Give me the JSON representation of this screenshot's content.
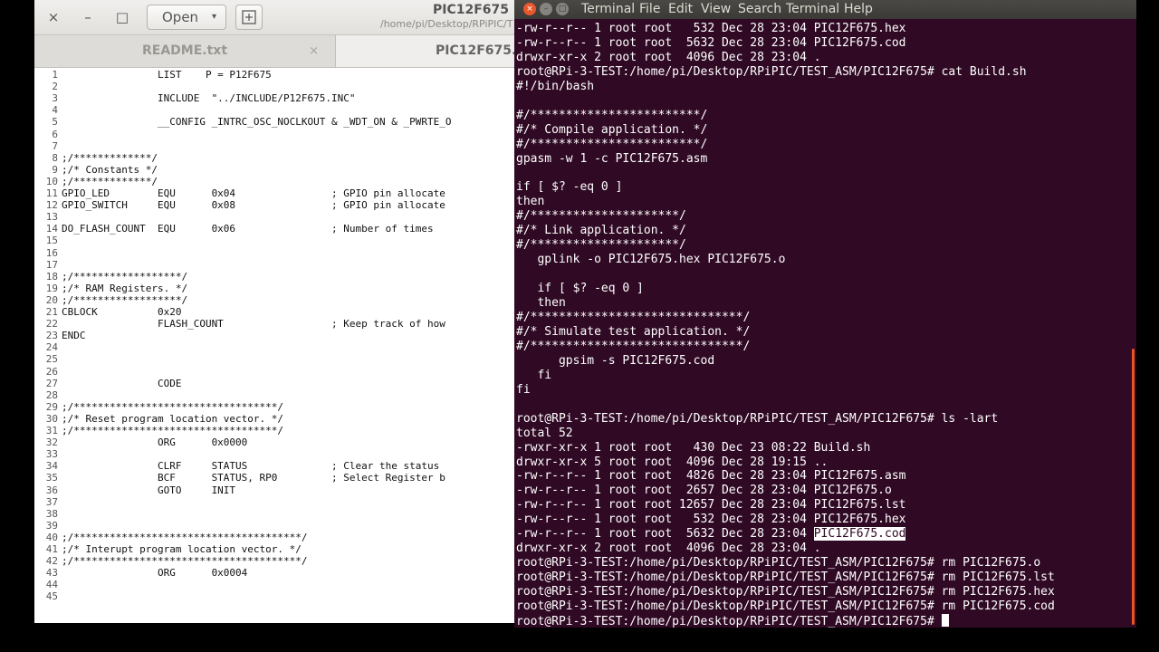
{
  "editor": {
    "window_buttons": {
      "close": "×",
      "minimize": "–",
      "maximize": "□"
    },
    "open_label": "Open",
    "open_chevron": "▾",
    "title": "PIC12F675",
    "path": "/home/pi/Desktop/RPiPIC/T",
    "tabs": [
      {
        "label": "README.txt",
        "close": "×"
      },
      {
        "label": "PIC12F675."
      }
    ],
    "lines": [
      {
        "n": "1",
        "text": "                LIST    P = P12F675"
      },
      {
        "n": "2",
        "text": ""
      },
      {
        "n": "3",
        "text": "                INCLUDE  \"../INCLUDE/P12F675.INC\""
      },
      {
        "n": "4",
        "text": ""
      },
      {
        "n": "5",
        "text": "                __CONFIG _INTRC_OSC_NOCLKOUT & _WDT_ON & _PWRTE_O"
      },
      {
        "n": "6",
        "text": ""
      },
      {
        "n": "7",
        "text": ""
      },
      {
        "n": "8",
        "text": ";/*************/"
      },
      {
        "n": "9",
        "text": ";/* Constants */"
      },
      {
        "n": "10",
        "text": ";/*************/"
      },
      {
        "n": "11",
        "text": "GPIO_LED        EQU      0x04                ; GPIO pin allocate"
      },
      {
        "n": "12",
        "text": "GPIO_SWITCH     EQU      0x08                ; GPIO pin allocate"
      },
      {
        "n": "13",
        "text": ""
      },
      {
        "n": "14",
        "text": "DO_FLASH_COUNT  EQU      0x06                ; Number of times "
      },
      {
        "n": "15",
        "text": ""
      },
      {
        "n": "16",
        "text": ""
      },
      {
        "n": "17",
        "text": ""
      },
      {
        "n": "18",
        "text": ";/******************/"
      },
      {
        "n": "19",
        "text": ";/* RAM Registers. */"
      },
      {
        "n": "20",
        "text": ";/******************/"
      },
      {
        "n": "21",
        "text": "CBLOCK          0x20"
      },
      {
        "n": "22",
        "text": "                FLASH_COUNT                  ; Keep track of how"
      },
      {
        "n": "23",
        "text": "ENDC"
      },
      {
        "n": "24",
        "text": ""
      },
      {
        "n": "25",
        "text": ""
      },
      {
        "n": "26",
        "text": ""
      },
      {
        "n": "27",
        "text": "                CODE"
      },
      {
        "n": "28",
        "text": ""
      },
      {
        "n": "29",
        "text": ";/**********************************/"
      },
      {
        "n": "30",
        "text": ";/* Reset program location vector. */"
      },
      {
        "n": "31",
        "text": ";/**********************************/"
      },
      {
        "n": "32",
        "text": "                ORG      0x0000"
      },
      {
        "n": "33",
        "text": ""
      },
      {
        "n": "34",
        "text": "                CLRF     STATUS              ; Clear the status"
      },
      {
        "n": "35",
        "text": "                BCF      STATUS, RP0         ; Select Register b"
      },
      {
        "n": "36",
        "text": "                GOTO     INIT"
      },
      {
        "n": "37",
        "text": ""
      },
      {
        "n": "38",
        "text": ""
      },
      {
        "n": "39",
        "text": ""
      },
      {
        "n": "40",
        "text": ";/**************************************/"
      },
      {
        "n": "41",
        "text": ";/* Interupt program location vector. */"
      },
      {
        "n": "42",
        "text": ";/**************************************/"
      },
      {
        "n": "43",
        "text": "                ORG      0x0004"
      },
      {
        "n": "44",
        "text": ""
      },
      {
        "n": "45",
        "text": ""
      }
    ]
  },
  "terminal": {
    "window_buttons": {
      "close": "×",
      "minimize": "–",
      "maximize": "□"
    },
    "menu": [
      "Terminal",
      "File",
      "Edit",
      "View",
      "Search",
      "Terminal",
      "Help"
    ],
    "lines": [
      "-rw-r--r-- 1 root root   532 Dec 28 23:04 PIC12F675.hex",
      "-rw-r--r-- 1 root root  5632 Dec 28 23:04 PIC12F675.cod",
      "drwxr-xr-x 2 root root  4096 Dec 28 23:04 .",
      "root@RPi-3-TEST:/home/pi/Desktop/RPiPIC/TEST_ASM/PIC12F675# cat Build.sh",
      "#!/bin/bash",
      "",
      "#/************************/",
      "#/* Compile application. */",
      "#/************************/",
      "gpasm -w 1 -c PIC12F675.asm",
      "",
      "if [ $? -eq 0 ]",
      "then",
      "#/*********************/",
      "#/* Link application. */",
      "#/*********************/",
      "   gplink -o PIC12F675.hex PIC12F675.o",
      "",
      "   if [ $? -eq 0 ]",
      "   then",
      "#/******************************/",
      "#/* Simulate test application. */",
      "#/******************************/",
      "      gpsim -s PIC12F675.cod",
      "   fi",
      "fi",
      "",
      "root@RPi-3-TEST:/home/pi/Desktop/RPiPIC/TEST_ASM/PIC12F675# ls -lart",
      "total 52",
      "-rwxr-xr-x 1 root root   430 Dec 23 08:22 Build.sh",
      "drwxr-xr-x 5 root root  4096 Dec 28 19:15 ..",
      "-rw-r--r-- 1 root root  4826 Dec 28 23:04 PIC12F675.asm",
      "-rw-r--r-- 1 root root  2657 Dec 28 23:04 PIC12F675.o",
      "-rw-r--r-- 1 root root 12657 Dec 28 23:04 PIC12F675.lst",
      "-rw-r--r-- 1 root root   532 Dec 28 23:04 PIC12F675.hex"
    ],
    "selected_line": {
      "prefix": "-rw-r--r-- 1 root root  5632 Dec 28 23:04 ",
      "selected": "PIC12F675.cod"
    },
    "lines_after": [
      "drwxr-xr-x 2 root root  4096 Dec 28 23:04 .",
      "root@RPi-3-TEST:/home/pi/Desktop/RPiPIC/TEST_ASM/PIC12F675# rm PIC12F675.o",
      "root@RPi-3-TEST:/home/pi/Desktop/RPiPIC/TEST_ASM/PIC12F675# rm PIC12F675.lst",
      "root@RPi-3-TEST:/home/pi/Desktop/RPiPIC/TEST_ASM/PIC12F675# rm PIC12F675.hex",
      "root@RPi-3-TEST:/home/pi/Desktop/RPiPIC/TEST_ASM/PIC12F675# rm PIC12F675.cod"
    ],
    "prompt": "root@RPi-3-TEST:/home/pi/Desktop/RPiPIC/TEST_ASM/PIC12F675# "
  }
}
